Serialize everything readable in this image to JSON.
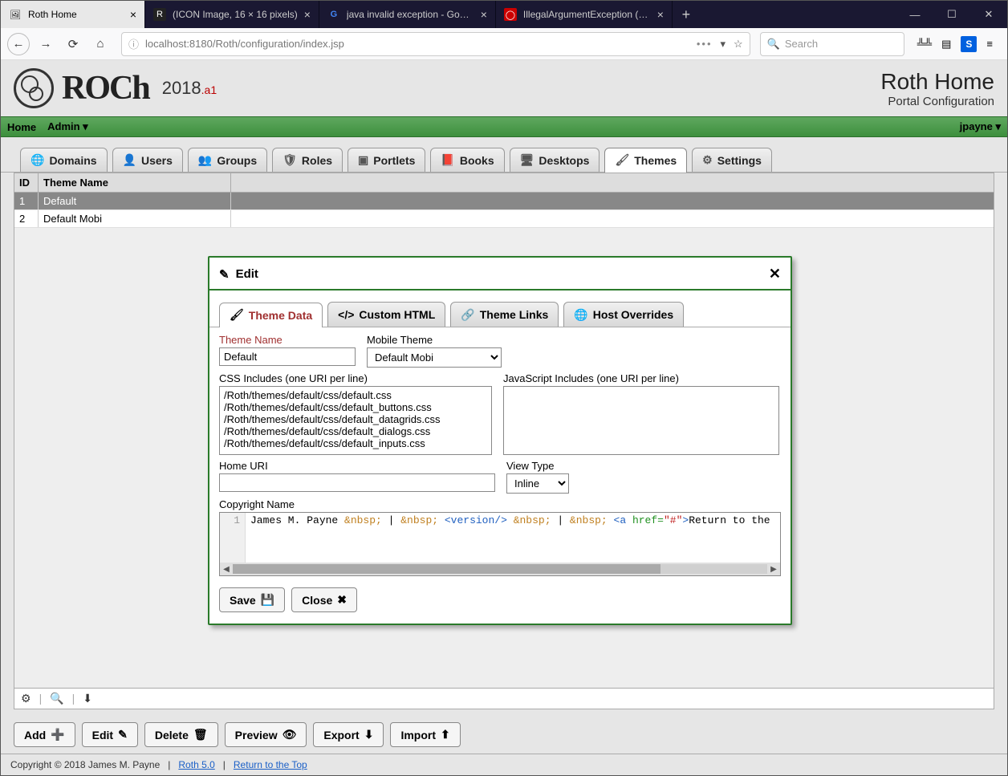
{
  "browser": {
    "tabs": [
      {
        "label": "Roth Home",
        "favicon": "🖼",
        "active": true
      },
      {
        "label": "(ICON Image, 16 × 16 pixels)",
        "favicon": "R"
      },
      {
        "label": "java invalid exception - Google",
        "favicon": "G"
      },
      {
        "label": "IllegalArgumentException (Jav…",
        "favicon": "◯"
      }
    ],
    "url": "localhost:8180/Roth/configuration/index.jsp",
    "search_placeholder": "Search"
  },
  "header": {
    "logo": "ROCh",
    "version": "2018",
    "suffix": ".a1",
    "title": "Roth Home",
    "subtitle": "Portal Configuration"
  },
  "menubar": {
    "home": "Home",
    "admin": "Admin ▾",
    "user": "jpayne ▾"
  },
  "admin_tabs": [
    {
      "icon": "🌐",
      "label": "Domains"
    },
    {
      "icon": "👤",
      "label": "Users"
    },
    {
      "icon": "👥",
      "label": "Groups"
    },
    {
      "icon": "🛡",
      "label": "Roles"
    },
    {
      "icon": "▣",
      "label": "Portlets"
    },
    {
      "icon": "📕",
      "label": "Books"
    },
    {
      "icon": "🖥",
      "label": "Desktops"
    },
    {
      "icon": "🖌",
      "label": "Themes",
      "active": true
    },
    {
      "icon": "⚙",
      "label": "Settings"
    }
  ],
  "grid": {
    "col_id": "ID",
    "col_name": "Theme Name",
    "rows": [
      {
        "id": "1",
        "name": "Default",
        "selected": true
      },
      {
        "id": "2",
        "name": "Default Mobi"
      }
    ]
  },
  "actions": {
    "add": "Add",
    "edit": "Edit",
    "delete": "Delete",
    "preview": "Preview",
    "export": "Export",
    "import": "Import"
  },
  "footer": {
    "copyright": "Copyright © 2018 James M. Payne",
    "link1": "Roth 5.0",
    "link2": "Return to the Top"
  },
  "dialog": {
    "title": "Edit",
    "tabs": {
      "data": "Theme Data",
      "html": "Custom HTML",
      "links": "Theme Links",
      "host": "Host Overrides"
    },
    "labels": {
      "theme_name": "Theme Name",
      "mobile_theme": "Mobile Theme",
      "css_includes": "CSS Includes (one URI per line)",
      "js_includes": "JavaScript Includes (one URI per line)",
      "home_uri": "Home URI",
      "view_type": "View Type",
      "copyright_name": "Copyright Name"
    },
    "values": {
      "theme_name": "Default",
      "mobile_theme": "Default Mobi",
      "css": "/Roth/themes/default/css/default.css\n/Roth/themes/default/css/default_buttons.css\n/Roth/themes/default/css/default_datagrids.css\n/Roth/themes/default/css/default_dialogs.css\n/Roth/themes/default/css/default_inputs.css",
      "js": "",
      "home_uri": "",
      "view_type": "Inline",
      "gutter": "1",
      "code_plain1": "James M. Payne ",
      "code_nbsp": "&nbsp;",
      "code_pipe": " | ",
      "code_ver": "<version/>",
      "code_a1": "<a ",
      "code_href": "href=",
      "code_hash": "\"#\"",
      "code_a2": ">",
      "code_ret": "Return to the"
    },
    "buttons": {
      "save": "Save",
      "close": "Close"
    }
  }
}
